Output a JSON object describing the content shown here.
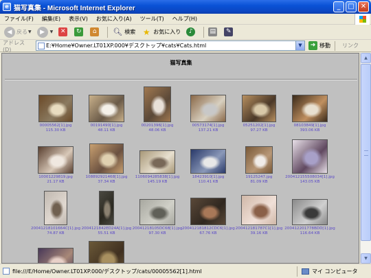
{
  "window": {
    "app_icon": "ie-icon",
    "title": "猫写真集 - Microsoft Internet Explorer",
    "buttons": {
      "minimize": "_",
      "maximize": "□",
      "close": "✕"
    }
  },
  "menu": [
    "ファイル(F)",
    "編集(E)",
    "表示(V)",
    "お気に入り(A)",
    "ツール(T)",
    "ヘルプ(H)"
  ],
  "toolbar": {
    "back_label": "戻る",
    "search_label": "検索",
    "favorites_label": "お気に入り"
  },
  "address": {
    "label": "アドレス(D)",
    "value": "E:¥Home¥Owner.LT01XP.000¥デスクトップ¥cats¥Cats.html",
    "go_label": "移動",
    "links_label": "リンク"
  },
  "page": {
    "title": "猫写真集",
    "photos": [
      {
        "name": "00005562[1].jpg",
        "size": "115.30 KB",
        "colors": [
          "#6b4a28",
          "#e8dcc0",
          "#8a7a60"
        ]
      },
      {
        "name": "00191490[1].jpg",
        "size": "48.11 KB",
        "colors": [
          "#c8b08a",
          "#f4f0e8",
          "#6a5a48"
        ]
      },
      {
        "name": "00201396[1].jpg",
        "size": "48.06 KB",
        "colors": [
          "#a07850",
          "#e8e0d8",
          "#5a4838"
        ]
      },
      {
        "name": "00573174[1].jpg",
        "size": "137.21 KB",
        "colors": [
          "#8a6848",
          "#c8c8c8",
          "#d8d0c0"
        ]
      },
      {
        "name": "05251202[1].jpg",
        "size": "97.27 KB",
        "colors": [
          "#b89060",
          "#d8c8a8",
          "#4a3828"
        ]
      },
      {
        "name": "08103849[1].jpg",
        "size": "393.06 KB",
        "colors": [
          "#3a2a1a",
          "#e8e0d0",
          "#c09060"
        ]
      },
      {
        "name": "10001229819.jpg",
        "size": "21.17 KB",
        "colors": [
          "#5a4030",
          "#f0e8e0",
          "#d8c8b8"
        ]
      },
      {
        "name": "108892921468[1].jpg",
        "size": "37.34 KB",
        "colors": [
          "#c8a070",
          "#e0d0b0",
          "#6a5040"
        ]
      },
      {
        "name": "1106094285838[1].jpg",
        "size": "145.19 KB",
        "colors": [
          "#a89878",
          "#786858",
          "#e8e0d0"
        ]
      },
      {
        "name": "18423910[1].jpg",
        "size": "110.41 KB",
        "colors": [
          "#2a3a6a",
          "#e8e8e8",
          "#8a98b8"
        ]
      },
      {
        "name": "19125247.jpg",
        "size": "81.09 KB",
        "colors": [
          "#7a5a38",
          "#f0ece8",
          "#b89878"
        ]
      },
      {
        "name": "200412155508034[1].jpg",
        "size": "143.05 KB",
        "colors": [
          "#e8e0e8",
          "#a8a0c8",
          "#604860"
        ]
      },
      {
        "name": "20041218101664C[1].jpg",
        "size": "74.87 KB",
        "colors": [
          "#c0b8b0",
          "#706050",
          "#e0d8d0"
        ]
      },
      {
        "name": "2004121842ED24A[1].jpg",
        "size": "55.51 KB",
        "colors": [
          "#4a4840",
          "#8a8070",
          "#2a2820"
        ]
      },
      {
        "name": "20041218105DC68[1].jpg",
        "size": "97.30 KB",
        "colors": [
          "#a8a8a0",
          "#606058",
          "#d0d0c8"
        ]
      },
      {
        "name": "200412181812CDC6[1].jpg",
        "size": "67.76 KB",
        "colors": [
          "#5a4838",
          "#a87858",
          "#302820"
        ]
      },
      {
        "name": "200412181787C1[1].jpg",
        "size": "39.16 KB",
        "colors": [
          "#d0b8a8",
          "#8a6048",
          "#f0e0d8"
        ]
      },
      {
        "name": "200412201778BDD[1].jpg",
        "size": "116.64 KB",
        "colors": [
          "#8a8a8a",
          "#3a3a3a",
          "#d0d0d0"
        ]
      },
      {
        "name": "",
        "size": "",
        "colors": [
          "#483858",
          "#e8d0c8",
          "#a88878"
        ]
      },
      {
        "name": "",
        "size": "",
        "colors": [
          "#6a5838",
          "#a89060",
          "#403020"
        ]
      }
    ]
  },
  "status": {
    "text": "file:///E/Home/Owner.LT01XP.000/デスクトップ/cats/00005562[1].html",
    "zone_label": "マイ コンピュータ"
  }
}
